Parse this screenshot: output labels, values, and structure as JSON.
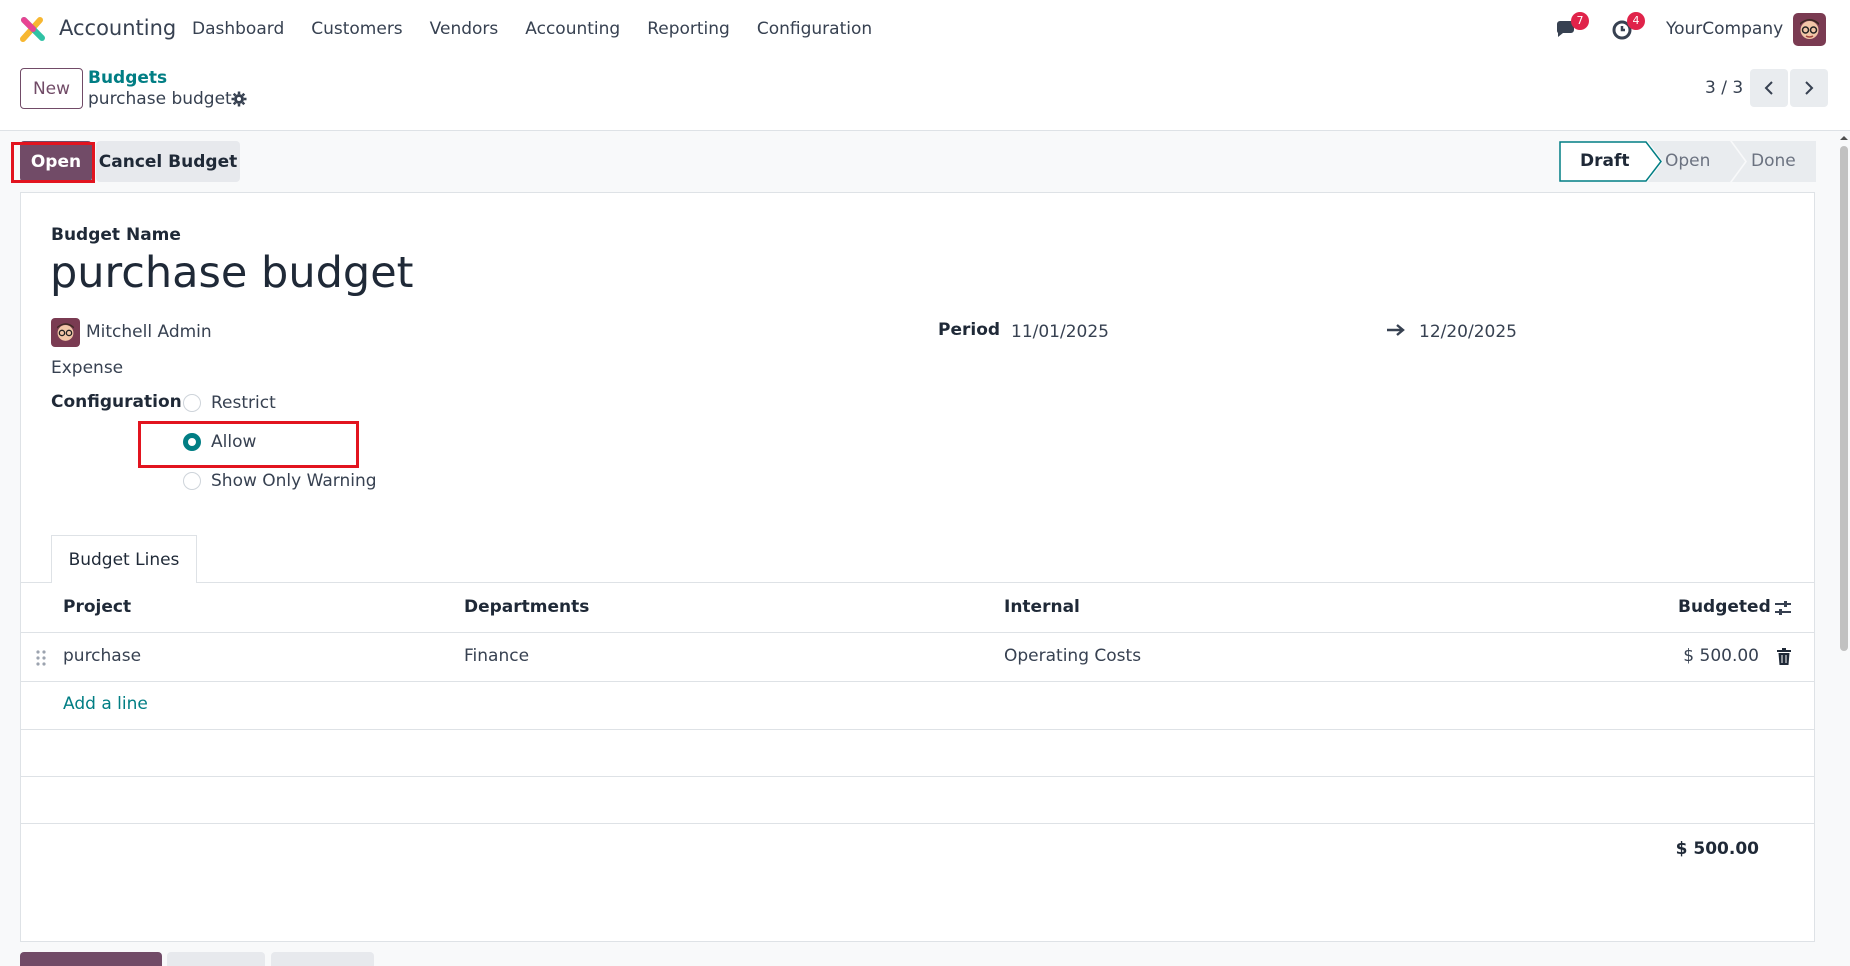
{
  "navbar": {
    "app_name": "Accounting",
    "menu": [
      "Dashboard",
      "Customers",
      "Vendors",
      "Accounting",
      "Reporting",
      "Configuration"
    ],
    "messages_count": "7",
    "activities_count": "4",
    "company": "YourCompany"
  },
  "control_panel": {
    "new_label": "New",
    "breadcrumb_parent": "Budgets",
    "breadcrumb_current": "purchase budget",
    "pager": "3 / 3"
  },
  "status_bar": {
    "open_label": "Open",
    "cancel_label": "Cancel Budget",
    "stages": [
      "Draft",
      "Open",
      "Done"
    ],
    "active_stage": "Draft"
  },
  "form": {
    "budget_name_label": "Budget Name",
    "budget_name": "purchase budget",
    "responsible": "Mitchell Admin",
    "budget_type": "Expense",
    "configuration_label": "Configuration",
    "configuration_options": [
      "Restrict",
      "Allow",
      "Show Only Warning"
    ],
    "configuration_selected": "Allow",
    "period_label": "Period",
    "period_start": "11/01/2025",
    "period_end": "12/20/2025"
  },
  "notebook": {
    "tab_label": "Budget Lines",
    "columns": [
      "Project",
      "Departments",
      "Internal",
      "Budgeted"
    ],
    "rows": [
      {
        "project": "purchase",
        "department": "Finance",
        "internal": "Operating Costs",
        "budgeted": "$ 500.00"
      }
    ],
    "add_line": "Add a line",
    "total": "$ 500.00"
  },
  "colors": {
    "primary": "#714b67",
    "teal": "#017e84",
    "highlight": "#e2141f"
  }
}
